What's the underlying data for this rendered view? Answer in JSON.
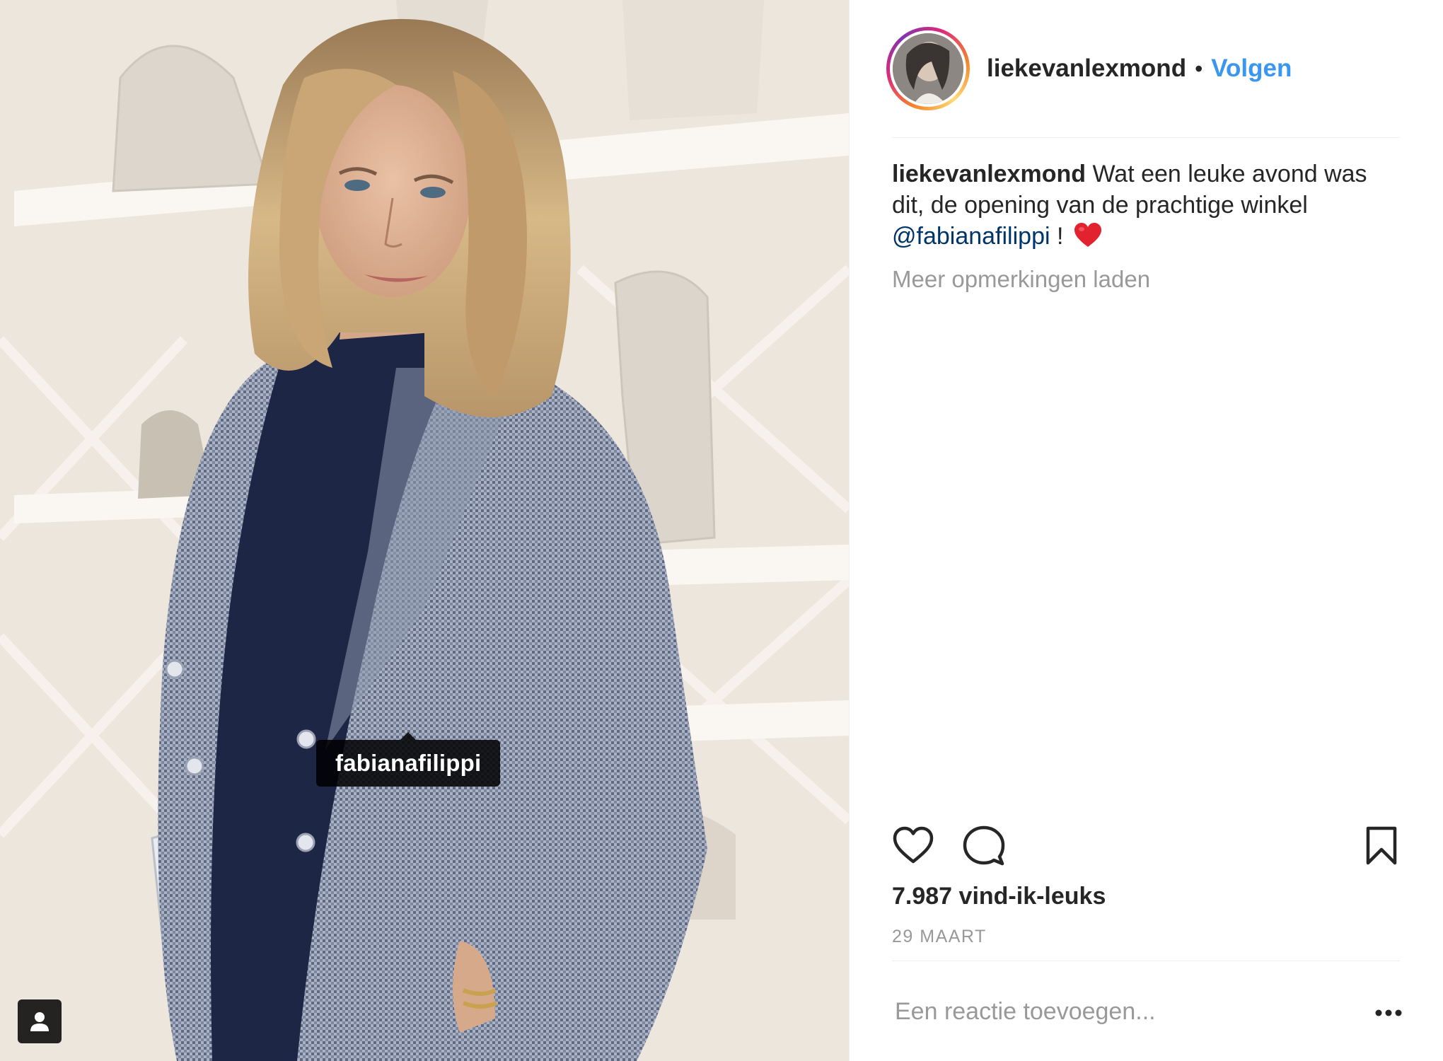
{
  "photo": {
    "tag": "fabianafilippi"
  },
  "header": {
    "username": "liekevanlexmond",
    "separator": "•",
    "follow_label": "Volgen"
  },
  "caption": {
    "username": "liekevanlexmond",
    "text": "Wat een leuke avond was dit, de opening van de prachtige winkel",
    "mention": "@fabianafilippi",
    "suffix": "!",
    "emoji": "red-heart-emoji"
  },
  "comments": {
    "load_more": "Meer opmerkingen laden"
  },
  "actions": {
    "icons": [
      "heart-icon",
      "comment-icon",
      "bookmark-icon"
    ]
  },
  "likes": "7.987 vind-ik-leuks",
  "date": "29 MAART",
  "comment_box": {
    "placeholder": "Een reactie toevoegen...",
    "more_icon": "more-options-icon"
  },
  "colors": {
    "accent": "#3897f0",
    "mention": "#003569",
    "muted": "#999999",
    "text": "#262626"
  }
}
